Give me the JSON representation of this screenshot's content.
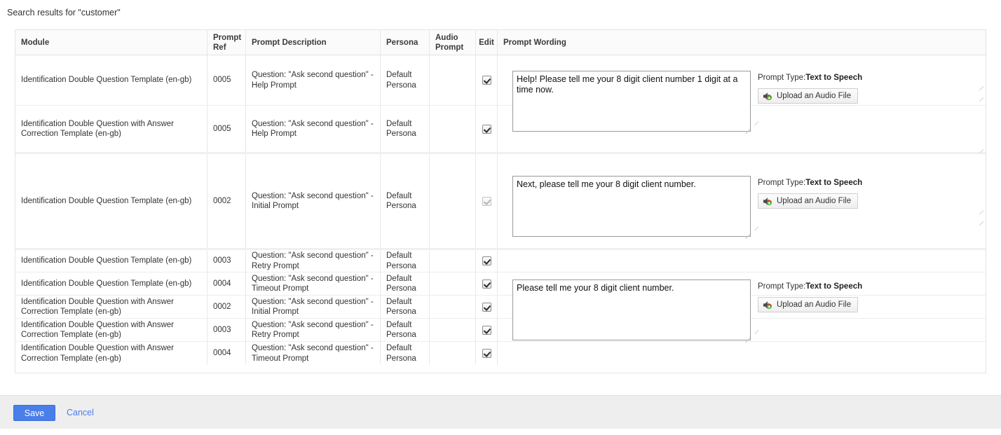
{
  "search": {
    "results_label": "Search results for \"customer\""
  },
  "table": {
    "columns": [
      {
        "key": "module",
        "label": "Module"
      },
      {
        "key": "ref",
        "label": "Prompt Ref"
      },
      {
        "key": "desc",
        "label": "Prompt Description"
      },
      {
        "key": "persona",
        "label": "Persona"
      },
      {
        "key": "audio",
        "label": "Audio Prompt"
      },
      {
        "key": "edit",
        "label": "Edit"
      },
      {
        "key": "wording",
        "label": "Prompt Wording"
      }
    ],
    "rows": [
      {
        "module": "Identification Double Question Template (en-gb)",
        "ref": "0005",
        "desc": "Question: \"Ask second question\" - Help Prompt",
        "persona": "Default Persona",
        "audio": "",
        "edit_checked": true,
        "edit_disabled": false
      },
      {
        "module": "Identification Double Question with Answer Correction Template (en-gb)",
        "ref": "0005",
        "desc": "Question: \"Ask second question\" - Help Prompt",
        "persona": "Default Persona",
        "audio": "",
        "edit_checked": true,
        "edit_disabled": false
      },
      {
        "module": "Identification Double Question Template (en-gb)",
        "ref": "0002",
        "desc": "Question: \"Ask second question\" - Initial Prompt",
        "persona": "Default Persona",
        "audio": "",
        "edit_checked": true,
        "edit_disabled": true
      },
      {
        "module": "Identification Double Question Template (en-gb)",
        "ref": "0003",
        "desc": "Question: \"Ask second question\" - Retry Prompt",
        "persona": "Default Persona",
        "audio": "",
        "edit_checked": true,
        "edit_disabled": false
      },
      {
        "module": "Identification Double Question Template (en-gb)",
        "ref": "0004",
        "desc": "Question: \"Ask second question\" - Timeout Prompt",
        "persona": "Default Persona",
        "audio": "",
        "edit_checked": true,
        "edit_disabled": false
      },
      {
        "module": "Identification Double Question with Answer Correction Template (en-gb)",
        "ref": "0002",
        "desc": "Question: \"Ask second question\" - Initial Prompt",
        "persona": "Default Persona",
        "audio": "",
        "edit_checked": true,
        "edit_disabled": false
      },
      {
        "module": "Identification Double Question with Answer Correction Template (en-gb)",
        "ref": "0003",
        "desc": "Question: \"Ask second question\" - Retry Prompt",
        "persona": "Default Persona",
        "audio": "",
        "edit_checked": true,
        "edit_disabled": false
      },
      {
        "module": "Identification Double Question with Answer Correction Template (en-gb)",
        "ref": "0004",
        "desc": "Question: \"Ask second question\" - Timeout Prompt",
        "persona": "Default Persona",
        "audio": "",
        "edit_checked": true,
        "edit_disabled": false
      }
    ]
  },
  "editors": [
    {
      "wording": "Help! Please tell me your 8 digit client number 1 digit at a time now.",
      "prompt_type_label": "Prompt Type:",
      "prompt_type_value": "Text to Speech",
      "upload_label": "Upload an Audio File"
    },
    {
      "wording": "Next, please tell me your 8 digit client number.",
      "prompt_type_label": "Prompt Type:",
      "prompt_type_value": "Text to Speech",
      "upload_label": "Upload an Audio File"
    },
    {
      "wording": "Please tell me your 8 digit client number.",
      "prompt_type_label": "Prompt Type:",
      "prompt_type_value": "Text to Speech",
      "upload_label": "Upload an Audio File"
    }
  ],
  "footer": {
    "save_label": "Save",
    "cancel_label": "Cancel"
  },
  "colors": {
    "accent": "#4a7ee8",
    "link": "#4a7ee8",
    "border": "#e3e3e3",
    "footer_bg": "#eeeeee"
  }
}
